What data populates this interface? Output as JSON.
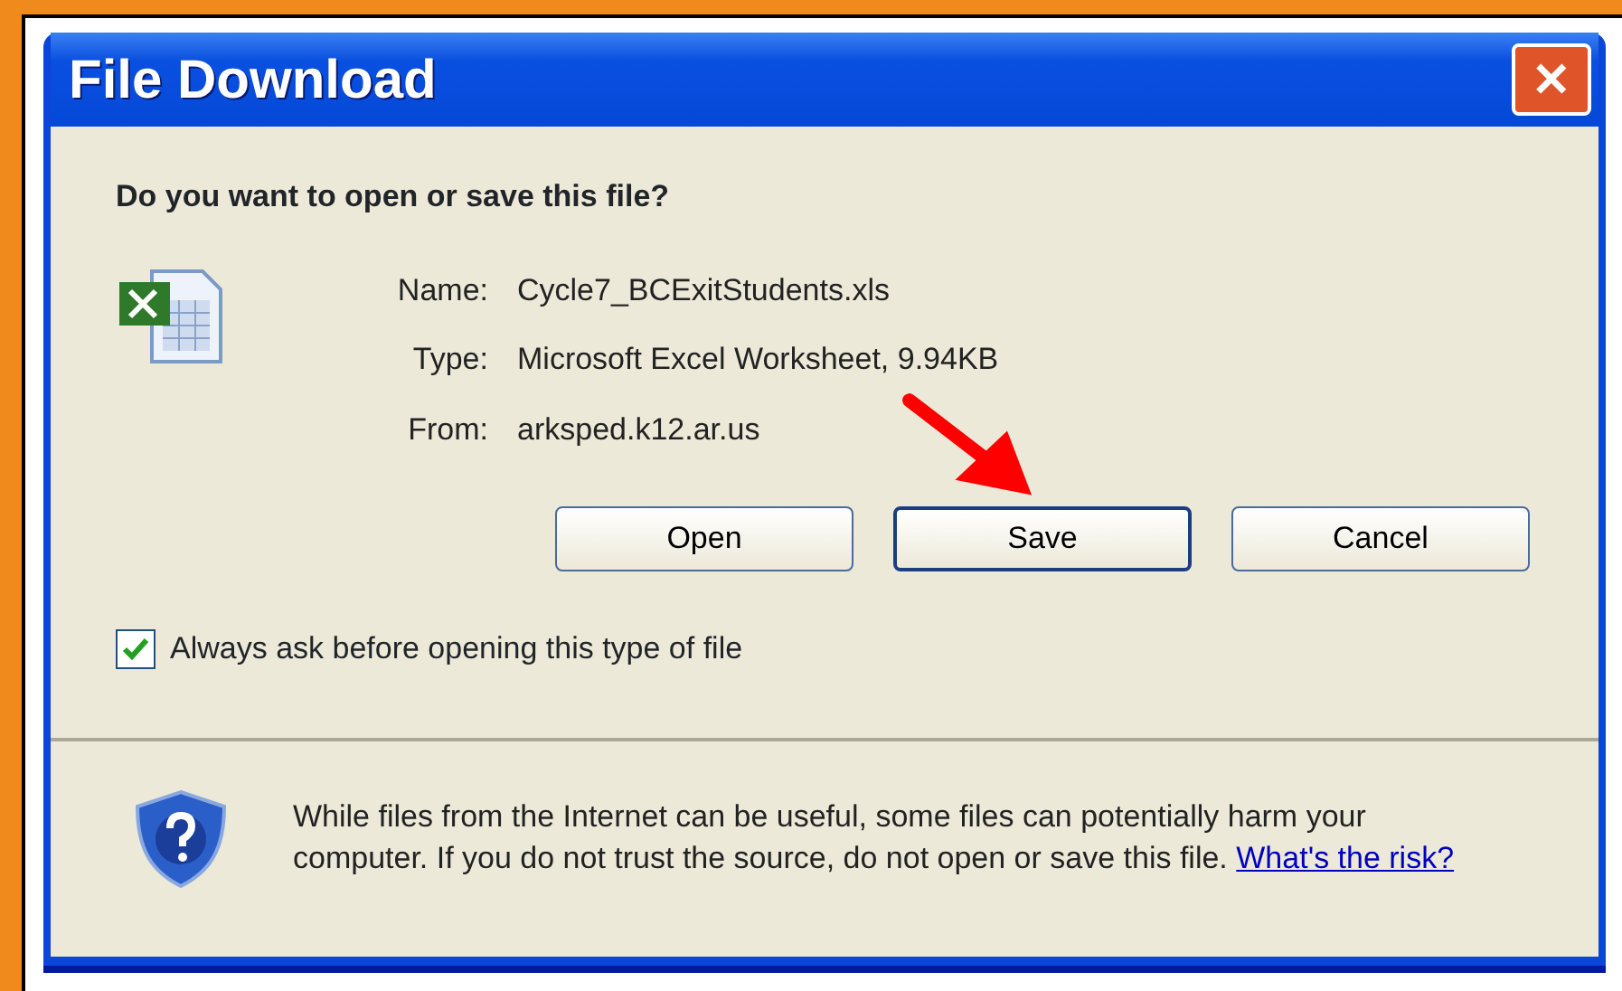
{
  "window": {
    "title": "File Download",
    "close": "✕"
  },
  "question": "Do you want to open or save this file?",
  "fields": [
    {
      "label": "Name:",
      "value": "Cycle7_BCExitStudents.xls"
    },
    {
      "label": "Type:",
      "value": "Microsoft Excel Worksheet, 9.94KB"
    },
    {
      "label": "From:",
      "value": "arksped.k12.ar.us"
    }
  ],
  "buttons": [
    {
      "label": "Open",
      "default": false
    },
    {
      "label": "Save",
      "default": true
    },
    {
      "label": "Cancel",
      "default": false
    }
  ],
  "always_ask": {
    "label": "Always ask before opening this type of file",
    "checked": true
  },
  "warning": {
    "text": "While files from the Internet can be useful, some files can potentially harm your computer. If you do not trust the source, do not open or save this file.",
    "link": "What's the risk?"
  }
}
